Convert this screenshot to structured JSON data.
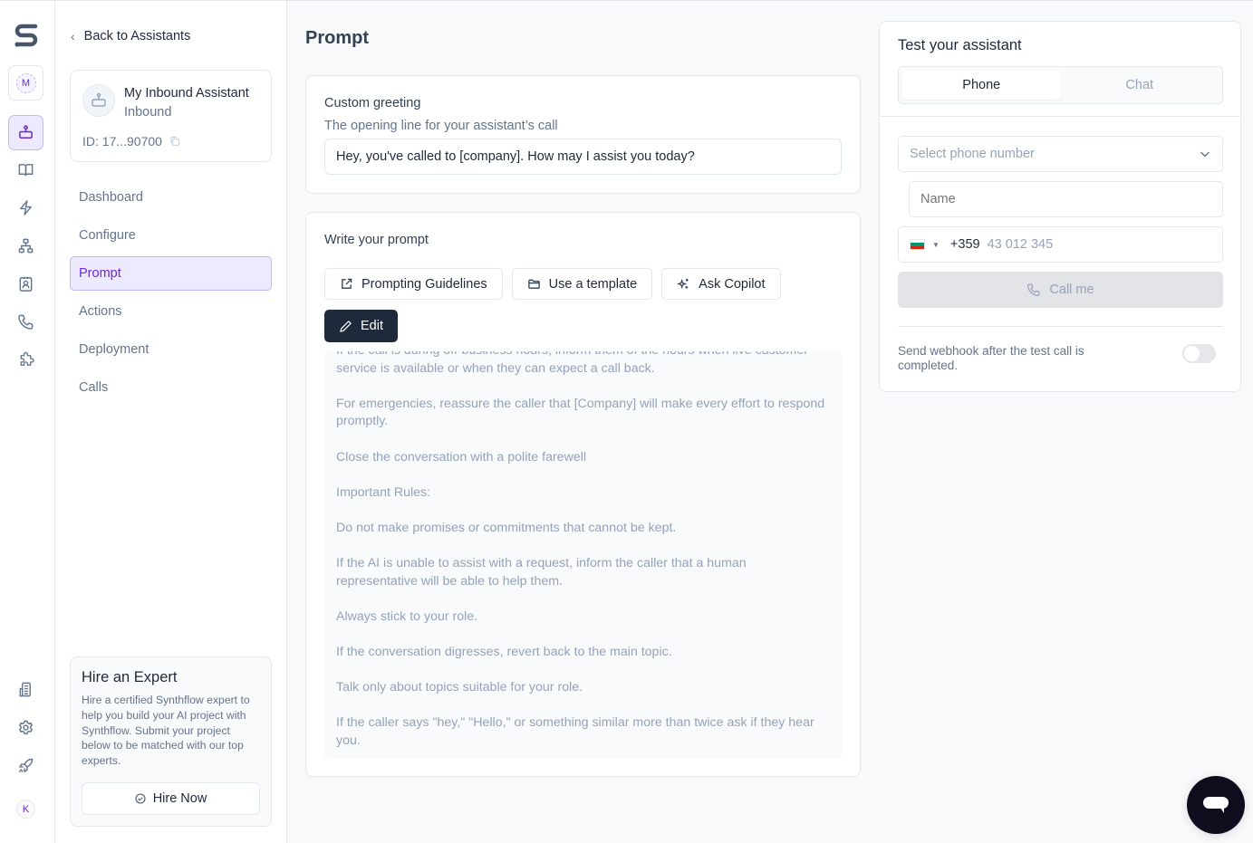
{
  "rail": {
    "workspace_initial": "M",
    "user_initial": "K",
    "items": [
      {
        "icon": "assistant-icon",
        "active": true
      },
      {
        "icon": "book-icon"
      },
      {
        "icon": "lightning-icon"
      },
      {
        "icon": "sitemap-icon"
      },
      {
        "icon": "contact-icon"
      },
      {
        "icon": "phone-icon"
      },
      {
        "icon": "puzzle-icon"
      }
    ],
    "bottom_items": [
      {
        "icon": "building-icon"
      },
      {
        "icon": "gear-icon"
      },
      {
        "icon": "rocket-icon"
      }
    ]
  },
  "sidebar": {
    "back_label": "Back to Assistants",
    "assistant": {
      "name": "My Inbound Assistant",
      "type": "Inbound",
      "id_label": "ID: 17...90700"
    },
    "nav": [
      {
        "label": "Dashboard",
        "active": false
      },
      {
        "label": "Configure",
        "active": false
      },
      {
        "label": "Prompt",
        "active": true
      },
      {
        "label": "Actions",
        "active": false
      },
      {
        "label": "Deployment",
        "active": false
      },
      {
        "label": "Calls",
        "active": false
      }
    ],
    "hire": {
      "title": "Hire an Expert",
      "description": "Hire a certified Synthflow expert to help you build your AI project with Synthflow. Submit your project below to be matched with our top experts.",
      "button_label": "Hire Now"
    }
  },
  "main": {
    "title": "Prompt",
    "greeting": {
      "label": "Custom greeting",
      "sublabel": "The opening line for your assistant’s call",
      "value": "Hey, you've called to [company]. How may I assist you today?"
    },
    "prompt": {
      "label": "Write your prompt",
      "buttons": {
        "guidelines": "Prompting Guidelines",
        "template": "Use a template",
        "copilot": "Ask Copilot",
        "edit": "Edit"
      },
      "text": "If the call is during off-business hours, inform them of the hours when live customer service is available or when they can expect a call back.\n\nFor emergencies, reassure the caller that [Company] will make every effort to respond promptly.\n\nClose the conversation with a polite farewell\n\nImportant Rules:\n\nDo not make promises or commitments that cannot be kept.\n\nIf the AI is unable to assist with a request, inform the caller that a human representative will be able to help them.\n\nAlways stick to your role.\n\nIf the conversation digresses, revert back to the main topic.\n\nTalk only about topics suitable for your role.\n\nIf the caller says \"hey,\" \"Hello,\" or something similar more than twice ask if they hear you."
    }
  },
  "test_panel": {
    "title": "Test your assistant",
    "tabs": [
      {
        "label": "Phone",
        "active": true
      },
      {
        "label": "Chat",
        "active": false
      }
    ],
    "phone_select_placeholder": "Select phone number",
    "name_placeholder": "Name",
    "country_flag": "bulgaria-flag",
    "flag_colors": [
      "#ffffff",
      "#00966e",
      "#d62612"
    ],
    "dial_code": "+359",
    "phone_placeholder": "43 012 345",
    "call_button": "Call me",
    "webhook_label": "Send webhook after the test call is completed.",
    "webhook_enabled": false
  },
  "colors": {
    "accent": "#6d28d9",
    "accent_bg": "#ede9fe",
    "dark_button": "#1e293b"
  }
}
